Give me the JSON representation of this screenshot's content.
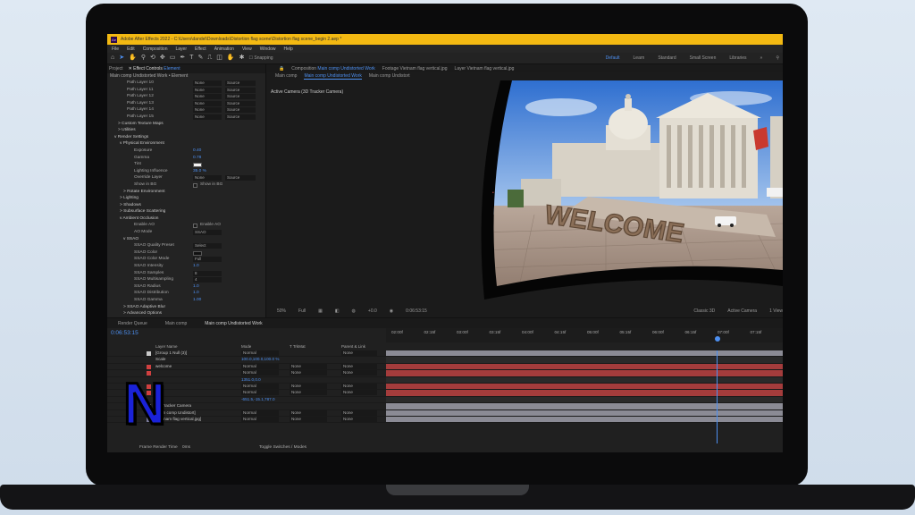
{
  "app": {
    "title": "Adobe After Effects 2022 - C:\\Users\\dandel\\Downloads\\Distortion flag scene\\Distortion flag scene_begin 2.aep *",
    "icon": "Ae"
  },
  "menu": [
    "File",
    "Edit",
    "Composition",
    "Layer",
    "Effect",
    "Animation",
    "View",
    "Window",
    "Help"
  ],
  "toolbar": {
    "snapping": "Snapping",
    "workspaces": [
      "Default",
      "Learn",
      "Standard",
      "Small Screen",
      "Libraries"
    ],
    "active_workspace": "Default"
  },
  "left_panel": {
    "tabs": [
      "Project",
      "Effect Controls",
      "Element"
    ],
    "header": "Main comp Undistorted Work • Element",
    "rows": [
      {
        "label": "Path Layer 10",
        "v1": "None",
        "v2": "Source"
      },
      {
        "label": "Path Layer 11",
        "v1": "None",
        "v2": "Source"
      },
      {
        "label": "Path Layer 12",
        "v1": "None",
        "v2": "Source"
      },
      {
        "label": "Path Layer 13",
        "v1": "None",
        "v2": "Source"
      },
      {
        "label": "Path Layer 14",
        "v1": "None",
        "v2": "Source"
      },
      {
        "label": "Path Layer 15",
        "v1": "None",
        "v2": "Source"
      },
      {
        "label": "> Custom Texture Maps"
      },
      {
        "label": "> Utilities"
      },
      {
        "label": "v Render Settings"
      },
      {
        "label": "v Physical Environment"
      },
      {
        "label": "Exposure",
        "val": "0.40"
      },
      {
        "label": "Gamma",
        "val": "0.78"
      },
      {
        "label": "Tint",
        "swatch": "light"
      },
      {
        "label": "Lighting Influence",
        "val": "35.0 %"
      },
      {
        "label": "Override Layer",
        "v1": "None",
        "v2": "Source"
      },
      {
        "label": "Show in BG",
        "cb": "Show in BG"
      },
      {
        "label": "> Rotate Environment"
      },
      {
        "label": "> Lighting"
      },
      {
        "label": "> Shadows"
      },
      {
        "label": "> Subsurface Scattering"
      },
      {
        "label": "v Ambient Occlusion"
      },
      {
        "label": "Enable AO",
        "cb": "Enable AO"
      },
      {
        "label": "AO Mode",
        "v1": "SSAO"
      },
      {
        "label": "v SSAO"
      },
      {
        "label": "SSAO Quality Preset",
        "v1": "Select"
      },
      {
        "label": "SSAO Color",
        "swatch": "dark"
      },
      {
        "label": "SSAO Color Mode",
        "v1": "Full"
      },
      {
        "label": "SSAO Intensity",
        "val": "1.0"
      },
      {
        "label": "SSAO Samples",
        "v1": "8"
      },
      {
        "label": "SSAO Multisampling",
        "v1": "4"
      },
      {
        "label": "SSAO Radius",
        "val": "1.0"
      },
      {
        "label": "SSAO Distribution",
        "val": "1.0"
      },
      {
        "label": "SSAO Gamma",
        "val": "1.00"
      },
      {
        "label": "> SSAO Adaptive Blur"
      },
      {
        "label": "> Advanced Options"
      }
    ]
  },
  "comp_panel": {
    "tabs": [
      "Composition",
      "Main comp Undistorted Work",
      "Footage",
      "Vietnam flag vertical.jpg",
      "Layer",
      "Vietnam flag vertical.jpg"
    ],
    "sub_tabs": [
      "Main comp",
      "Main comp Undistorted Work",
      "Main comp Undistort"
    ],
    "active_camera": "Active Camera (3D Tracker Camera)",
    "overlay_text": "WELCOME",
    "footer": {
      "zoom": "50%",
      "resolution": "Full",
      "timecode": "0:06:53:15",
      "plus": "+0.0",
      "renderer": "Classic 3D",
      "view_camera": "Active Camera",
      "views": "1 View"
    }
  },
  "timeline": {
    "tabs": [
      "Render Queue",
      "Main comp",
      "Main comp Undistorted Work"
    ],
    "timecode": "0:06:53:15",
    "ruler_ticks": [
      "02:00f",
      "02:15f",
      "03:00f",
      "03:15f",
      "04:00f",
      "04:15f",
      "05:00f",
      "05:15f",
      "06:00f",
      "06:15f",
      "07:00f",
      "07:15f"
    ],
    "columns": [
      "Layer Name",
      "Mode",
      "T TrkMat",
      "Parent & Link"
    ],
    "layers": [
      {
        "name": "[Group 1 Null (3)]",
        "mode": "Normal",
        "parent": "None",
        "color": "#c8c8c8"
      },
      {
        "name": "Scale",
        "blue": "100.0,100.0,100.0 %"
      },
      {
        "name": "welcome",
        "mode": "Normal",
        "trk": "None",
        "parent": "None",
        "color": "#d04040"
      },
      {
        "name": "",
        "mode": "Normal",
        "trk": "None",
        "parent": "None",
        "color": "#d04040"
      },
      {
        "name": "",
        "blue": "1351.0,0.0"
      },
      {
        "name": "",
        "mode": "Normal",
        "trk": "None",
        "parent": "None",
        "color": "#d04040"
      },
      {
        "name": "",
        "mode": "Normal",
        "trk": "None",
        "parent": "None",
        "color": "#d04040"
      },
      {
        "name": "",
        "blue": "-651.5,-15.1,787.0"
      },
      {
        "name": "3D Tracker Camera",
        "color": "#c8c8c8"
      },
      {
        "name": "[Main comp Undistort]",
        "mode": "Normal",
        "trk": "None",
        "parent": "None",
        "color": "#7a7a9a"
      },
      {
        "name": "[Vietnam flag vertical.jpg]",
        "mode": "Normal",
        "trk": "None",
        "parent": "None",
        "color": "#7a7a9a"
      }
    ],
    "footer": {
      "render_time": "Frame Render Time",
      "time_value": "0ms",
      "toggle": "Toggle Switches / Modes"
    }
  },
  "brand": {
    "logo_letter": "N",
    "logo_color": "#1a22d8"
  }
}
